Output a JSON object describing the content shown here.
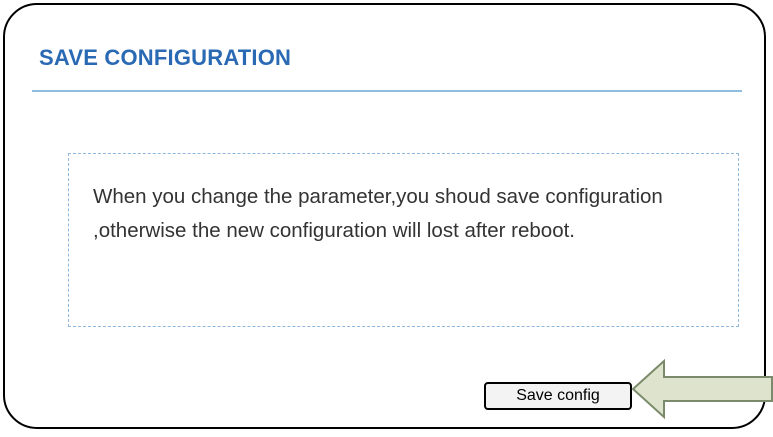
{
  "panel": {
    "title": "SAVE CONFIGURATION",
    "note": "When you change the parameter,you shoud save configuration ,otherwise the new configuration will lost after reboot."
  },
  "actions": {
    "save_label": "Save config"
  },
  "colors": {
    "title": "#2a6ab4",
    "title_rule": "#8fbde0",
    "note_border": "#8fb6dc",
    "arrow_fill": "#dde3cc",
    "arrow_stroke": "#7b8a6a"
  },
  "icons": {
    "pointer": "left-arrow-icon"
  }
}
